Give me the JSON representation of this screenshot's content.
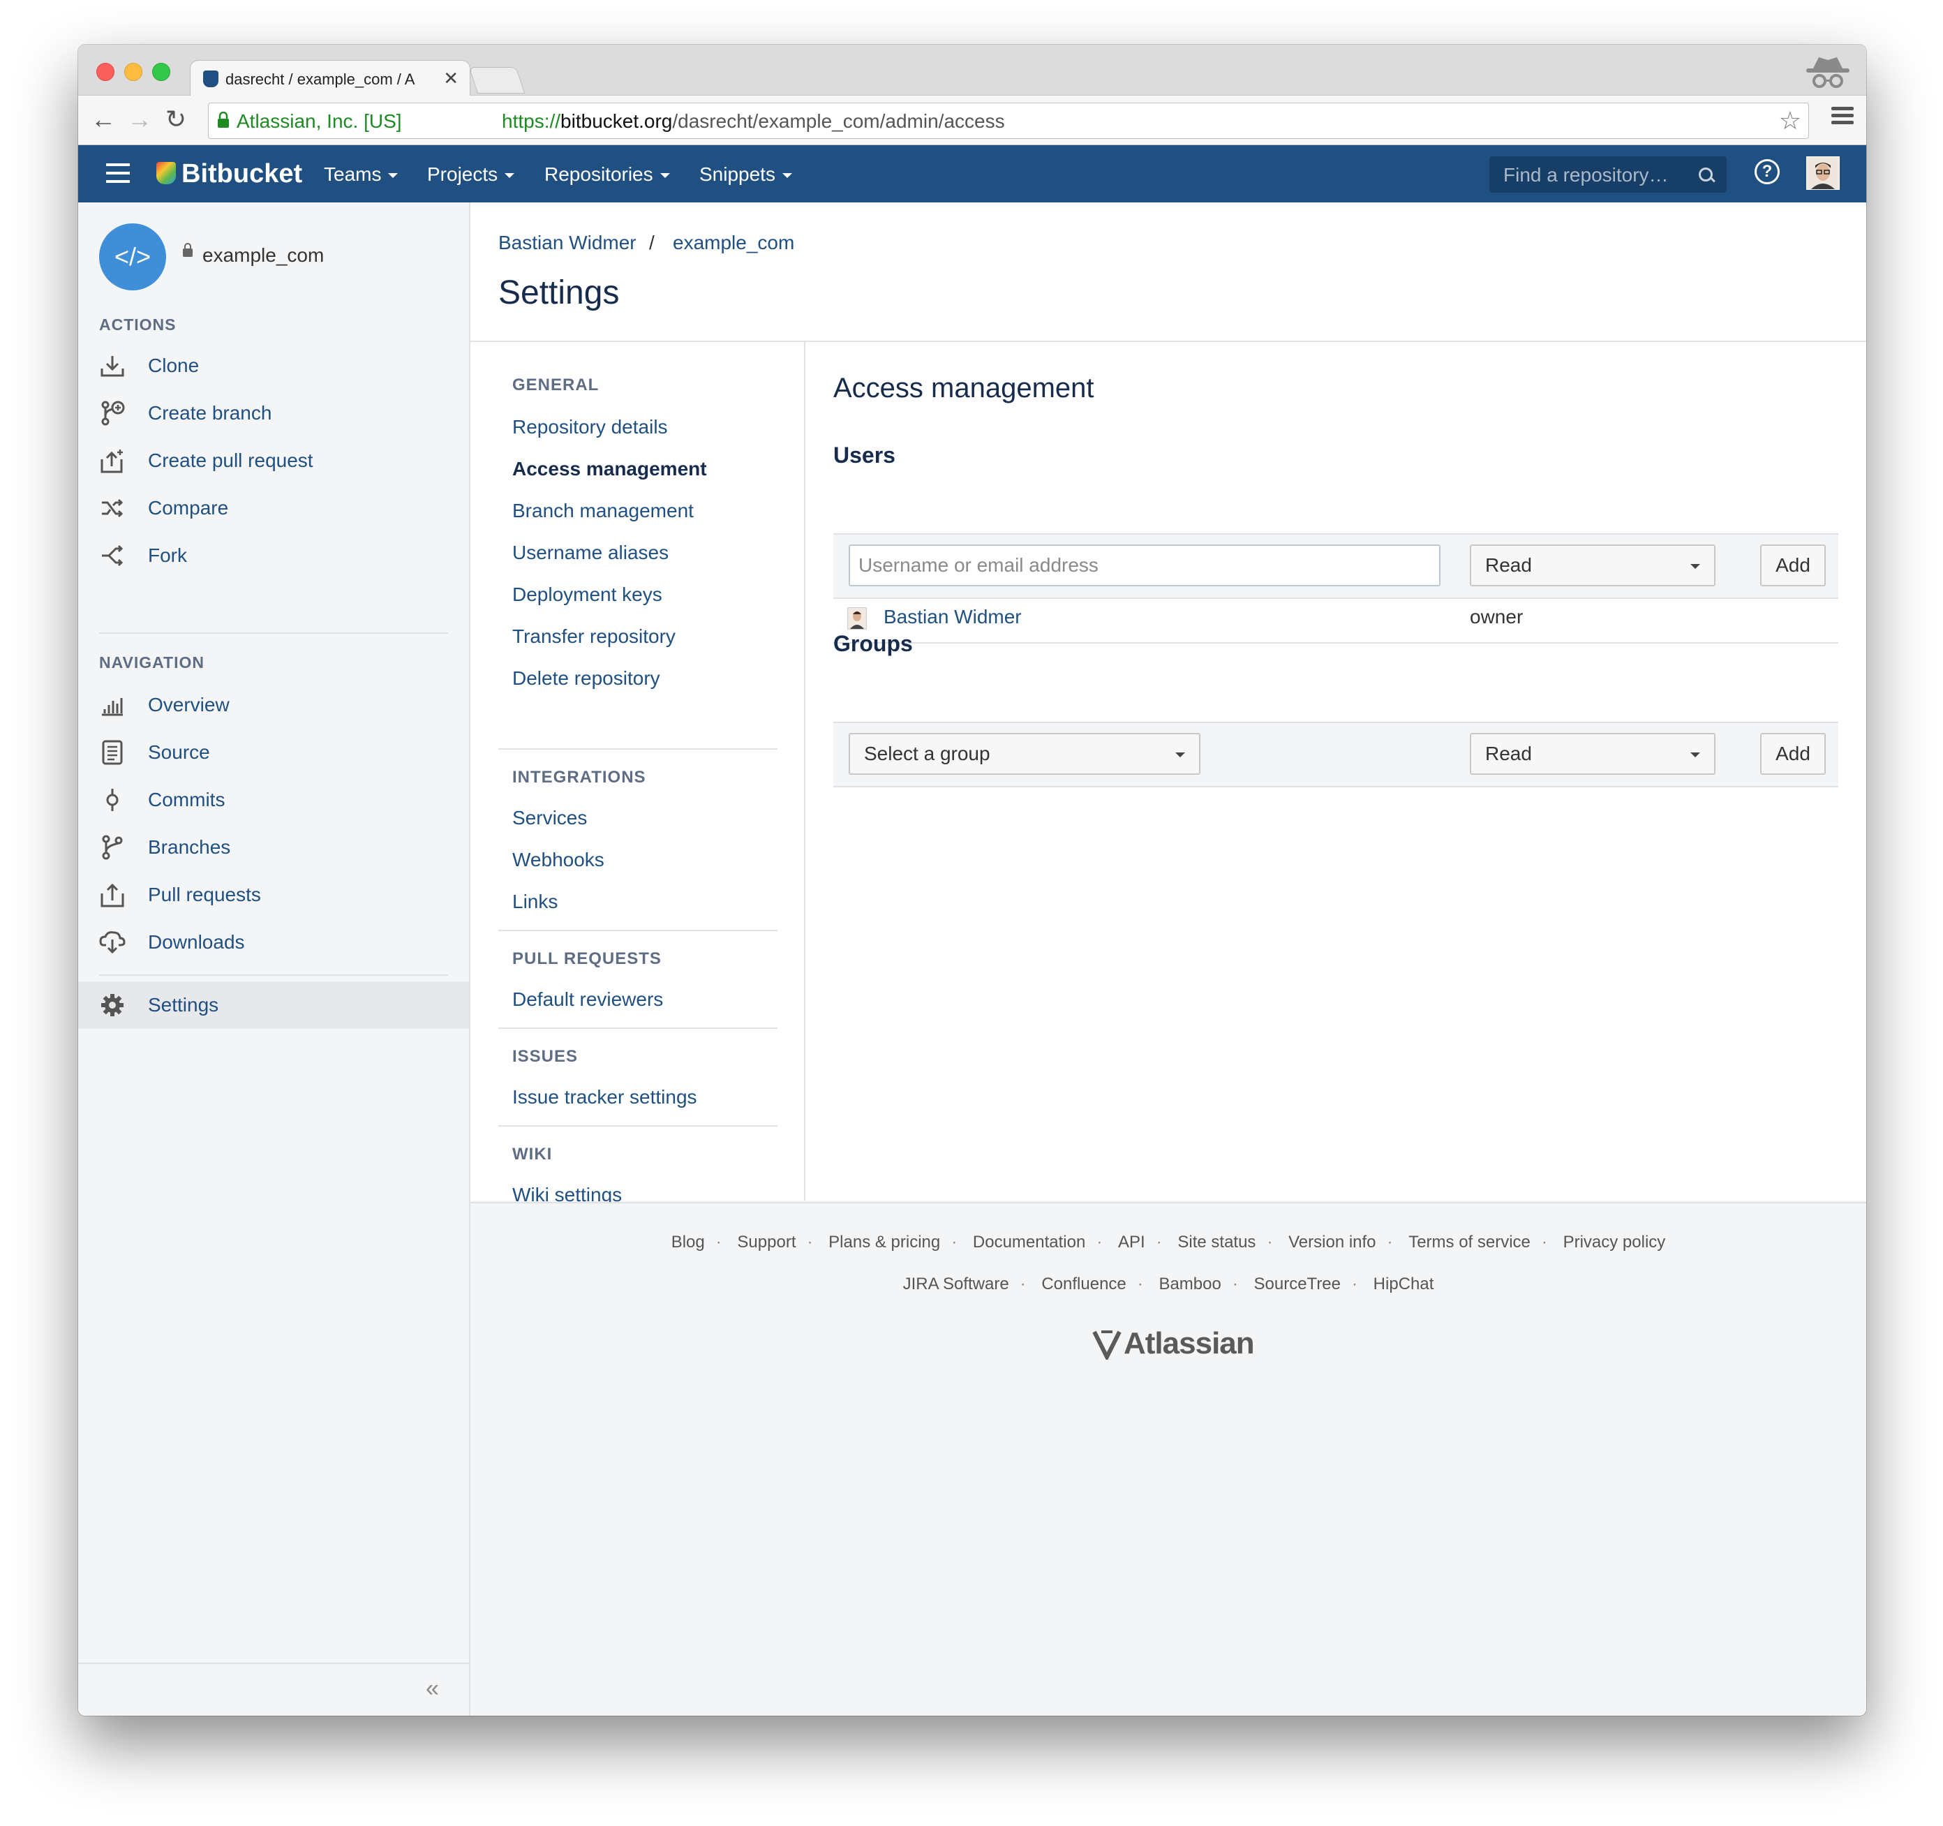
{
  "browser": {
    "tab_title": "dasrecht / example_com / A",
    "tab_close": "✕",
    "cert_label": "Atlassian, Inc. [US]",
    "url_scheme": "https://",
    "url_host": "bitbucket.org",
    "url_path": "/dasrecht/example_com/admin/access"
  },
  "header": {
    "logo": "Bitbucket",
    "nav": [
      "Teams",
      "Projects",
      "Repositories",
      "Snippets"
    ],
    "search_placeholder": "Find a repository…",
    "help": "?"
  },
  "sidebar": {
    "repo_name": "example_com",
    "repo_icon": "</>",
    "actions_heading": "ACTIONS",
    "actions": [
      {
        "label": "Clone",
        "icon": "download-icon"
      },
      {
        "label": "Create branch",
        "icon": "create-branch-icon"
      },
      {
        "label": "Create pull request",
        "icon": "create-pull-request-icon"
      },
      {
        "label": "Compare",
        "icon": "compare-icon"
      },
      {
        "label": "Fork",
        "icon": "fork-icon"
      }
    ],
    "navigation_heading": "NAVIGATION",
    "navigation": [
      {
        "label": "Overview",
        "icon": "overview-icon"
      },
      {
        "label": "Source",
        "icon": "source-icon"
      },
      {
        "label": "Commits",
        "icon": "commits-icon"
      },
      {
        "label": "Branches",
        "icon": "branches-icon"
      },
      {
        "label": "Pull requests",
        "icon": "pull-requests-icon"
      },
      {
        "label": "Downloads",
        "icon": "downloads-icon"
      }
    ],
    "settings": {
      "label": "Settings",
      "icon": "gear-icon"
    },
    "collapse": "«"
  },
  "breadcrumb": {
    "owner": "Bastian Widmer",
    "separator": "/",
    "repo": "example_com"
  },
  "page_title": "Settings",
  "settings_nav": {
    "general_heading": "GENERAL",
    "general": [
      "Repository details",
      "Access management",
      "Branch management",
      "Username aliases",
      "Deployment keys",
      "Transfer repository",
      "Delete repository"
    ],
    "integrations_heading": "INTEGRATIONS",
    "integrations": [
      "Services",
      "Webhooks",
      "Links"
    ],
    "pull_requests_heading": "PULL REQUESTS",
    "pull_requests": [
      "Default reviewers"
    ],
    "issues_heading": "ISSUES",
    "issues": [
      "Issue tracker settings"
    ],
    "wiki_heading": "WIKI",
    "wiki": [
      "Wiki settings"
    ],
    "current": "Access management"
  },
  "access": {
    "title": "Access management",
    "users_heading": "Users",
    "user_input_placeholder": "Username or email address",
    "user_permission": "Read",
    "add_label": "Add",
    "users": [
      {
        "name": "Bastian Widmer",
        "role": "owner"
      }
    ],
    "groups_heading": "Groups",
    "group_select": "Select a group",
    "group_permission": "Read"
  },
  "footer": {
    "links_row1": [
      "Blog",
      "Support",
      "Plans & pricing",
      "Documentation",
      "API",
      "Site status",
      "Version info",
      "Terms of service",
      "Privacy policy"
    ],
    "links_row2": [
      "JIRA Software",
      "Confluence",
      "Bamboo",
      "SourceTree",
      "HipChat"
    ],
    "brand": "Atlassian",
    "separator": "·"
  },
  "colors": {
    "header_bg": "#205081",
    "link": "#205081",
    "sidebar_bg": "#f4f5f7"
  }
}
